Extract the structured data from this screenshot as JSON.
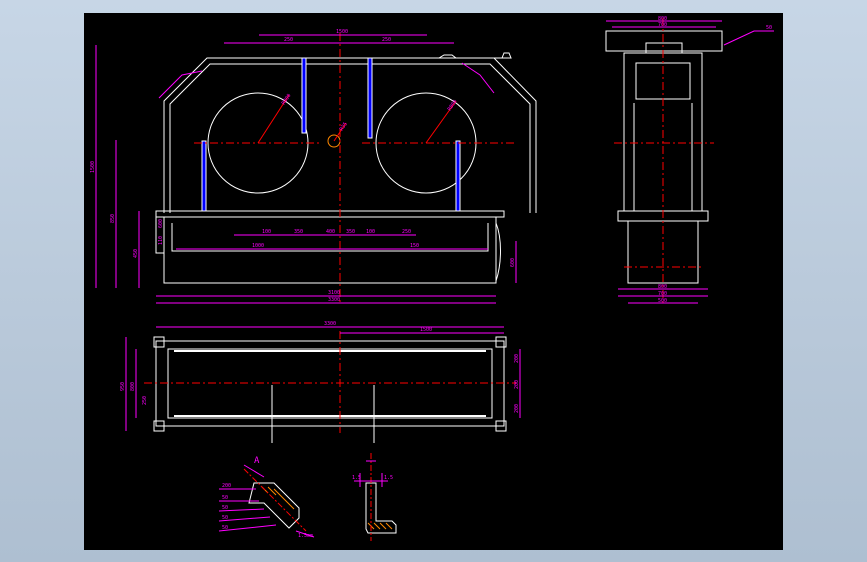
{
  "colors": {
    "background": "#000000",
    "outline": "#ffffff",
    "dimension": "#ff00ff",
    "centerline": "#ff0000",
    "accent": "#0000ff",
    "window_backdrop": "#c7d6e6"
  },
  "front_view": {
    "top_dims": [
      "250",
      "1500",
      "250"
    ],
    "mid_dims": [
      "100",
      "350",
      "400",
      "350",
      "100",
      "250"
    ],
    "lower_dims": [
      "1000",
      "150"
    ],
    "bottom_dims": [
      "3100",
      "3300"
    ],
    "left_dims": [
      "1500",
      "850",
      "450",
      "600",
      "110"
    ],
    "right_dims": [
      "600"
    ],
    "circle_labels": [
      "R800",
      "R800",
      "R35"
    ]
  },
  "side_view": {
    "top_dims": [
      "800",
      "700"
    ],
    "right_dims": [
      "50"
    ],
    "bottom_dims": [
      "800",
      "700",
      "500"
    ]
  },
  "plan_view": {
    "top_dims": [
      "3300",
      "1500"
    ],
    "left_dims": [
      "950",
      "800",
      "250"
    ],
    "right_dims": [
      "200",
      "200",
      "200"
    ]
  },
  "detail_views": {
    "detail_a_title": "A",
    "detail_a_note": "1.5mm",
    "detail_a_labels": [
      "200",
      "50",
      "50",
      "50",
      "50"
    ],
    "detail_b_labels": [
      "1.5",
      "1.5"
    ]
  }
}
